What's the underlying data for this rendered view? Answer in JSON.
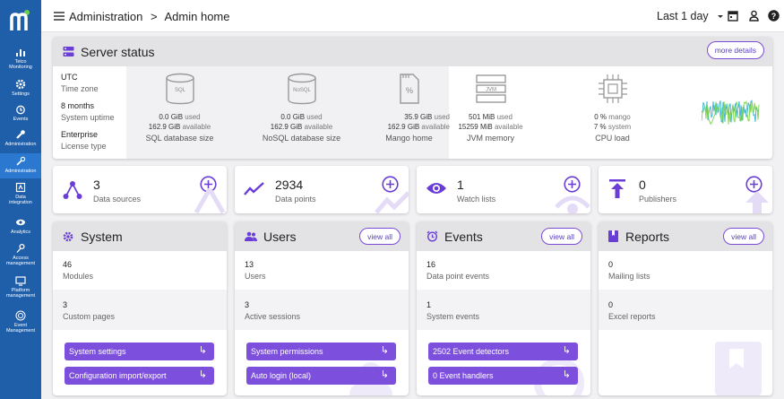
{
  "breadcrumb": {
    "parent": "Administration",
    "separator": ">",
    "current": "Admin home"
  },
  "topbar": {
    "time_range": "Last 1 day"
  },
  "sidenav": [
    {
      "label1": "Telco",
      "label2": "Monitoring"
    },
    {
      "label1": "Settings",
      "label2": ""
    },
    {
      "label1": "Events",
      "label2": ""
    },
    {
      "label1": "Administration",
      "label2": ""
    },
    {
      "label1": "Administration",
      "label2": ""
    },
    {
      "label1": "Data",
      "label2": "integration"
    },
    {
      "label1": "Analytics",
      "label2": ""
    },
    {
      "label1": "Access",
      "label2": "management"
    },
    {
      "label1": "Platform",
      "label2": "management"
    },
    {
      "label1": "Event",
      "label2": "Management"
    }
  ],
  "server_status": {
    "title": "Server status",
    "more_details": "more details",
    "info": [
      {
        "value": "UTC",
        "label": "Time zone"
      },
      {
        "value": "8 months",
        "label": "System uptime"
      },
      {
        "value": "Enterprise",
        "label": "License type"
      }
    ],
    "sql": {
      "icon_text": "SQL",
      "used": "0.0 GiB",
      "used_word": "used",
      "avail": "162.9 GiB",
      "avail_word": "available",
      "title": "SQL database size"
    },
    "nosql": {
      "icon_text": "NoSQL",
      "used": "0.0 GiB",
      "used_word": "used",
      "avail": "162.9 GiB",
      "avail_word": "available",
      "title": "NoSQL database size"
    },
    "mango": {
      "icon_text": "%",
      "used": "35.9 GiB",
      "used_word": "used",
      "avail": "162.9 GiB",
      "avail_word": "available",
      "title": "Mango home"
    },
    "jvm": {
      "icon_text": "JVM",
      "used": "501 MiB",
      "used_word": "used",
      "avail": "15259 MiB",
      "avail_word": "available",
      "title": "JVM memory"
    },
    "cpu": {
      "used": "0 %",
      "used_word": "mango",
      "avail": "7 %",
      "avail_word": "system",
      "title": "CPU load"
    }
  },
  "stats": [
    {
      "count": "3",
      "label": "Data sources"
    },
    {
      "count": "2934",
      "label": "Data points"
    },
    {
      "count": "1",
      "label": "Watch lists"
    },
    {
      "count": "0",
      "label": "Publishers"
    }
  ],
  "system": {
    "title": "System",
    "r1v": "46",
    "r1l": "Modules",
    "r2v": "3",
    "r2l": "Custom pages",
    "btn1": "System settings",
    "btn2": "Configuration import/export"
  },
  "users": {
    "title": "Users",
    "view_all": "view all",
    "r1v": "13",
    "r1l": "Users",
    "r2v": "3",
    "r2l": "Active sessions",
    "btn1": "System permissions",
    "btn2": "Auto login (local)"
  },
  "events": {
    "title": "Events",
    "view_all": "view all",
    "r1v": "16",
    "r1l": "Data point events",
    "r2v": "1",
    "r2l": "System events",
    "btn1": "2502  Event detectors",
    "btn2": "0  Event handlers"
  },
  "reports": {
    "title": "Reports",
    "view_all": "view all",
    "r1v": "0",
    "r1l": "Mailing lists",
    "r2v": "0",
    "r2l": "Excel reports"
  },
  "colors": {
    "sidenav": "#1f5ea8",
    "accent": "#7c4fdc",
    "active_nav": "#2a78d0"
  }
}
